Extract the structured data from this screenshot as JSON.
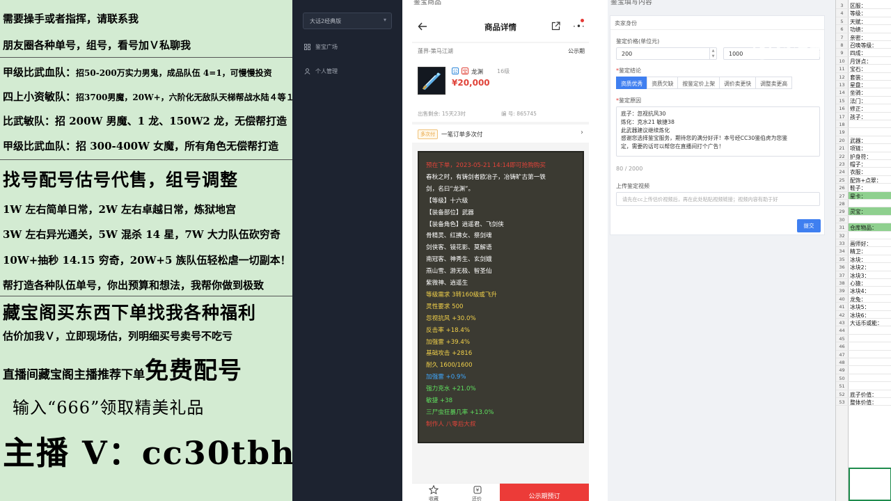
{
  "promo": {
    "lines": [
      "需要操手或者指挥，请联系我",
      "朋友圈各种单号，组号，看号加Ｖ私聊我",
      "甲级比武血队：",
      "招50-200万实力男鬼，成品队伍 4=1，可慢慢投资",
      "四上小资敏队：",
      "招3700男魔，20W+，六阶化无敌队天梯帮战水陆４等１",
      "比武敏队：招 200W 男魔、1 龙、150W2 龙，无偿帮打造",
      "甲级比武血队：招 300-400W 女魔，所有角色无偿帮打造",
      "找号配号估号代售，组号调整",
      "1W 左右简单日常，2W 左右卓越日常，炼狱地宫",
      "3W 左右异光通关，5W 混杀 14 星，7W 大力队伍砍穷奇",
      "10W+抽秒 14.15 穷奇，20W+5 族队伍轻松虐一切副本！",
      "帮打造各种队伍单号，你出预算和想法，我帮你做到极致",
      "藏宝阁买东西下单找我各种福利",
      "估价加我Ｖ，立即现场估，列明细买号卖号不吃亏",
      "直播间藏宝阁主播推荐下单",
      "免费配号",
      "输入“666”领取精美礼品",
      "主播 V：cc30tbh"
    ]
  },
  "sidebar": {
    "game_select": "大话2经典版",
    "items": [
      {
        "label": "鉴宝广场",
        "icon": "grid-icon"
      },
      {
        "label": "个人管理",
        "icon": "user-icon"
      }
    ]
  },
  "phone": {
    "top_label": "鉴宝商品",
    "nav_title": "商品详情",
    "server": "蓬界-策马江湖",
    "status": "公示期",
    "badge_1": "公",
    "badge_2": "宝",
    "item_name": "龙渊",
    "item_level": "16级",
    "price": "¥20,000",
    "remaining": "出售剩余: 15天23时",
    "serial": "编 号: 865745",
    "pay_tag": "多次付",
    "pay_text": "一笔订单多次付",
    "description": [
      {
        "t": "预在下单，2023-05-21 14:14即可抢购购买",
        "c": "#e0443a"
      },
      {
        "t": "春秋之时，有铸剑者欧冶子，冶铸旷古第一铁",
        "c": "#ffffff"
      },
      {
        "t": "剑，名曰“龙渊”。",
        "c": "#ffffff"
      },
      {
        "t": "【等级】十六级",
        "c": "#ffffff"
      },
      {
        "t": "【装备部位】武器",
        "c": "#ffffff"
      },
      {
        "t": "【装备角色】逍遥君、飞剑侠",
        "c": "#ffffff"
      },
      {
        "t": "骨精灵、红拂女、祭剑魂",
        "c": "#ffffff"
      },
      {
        "t": "剑侠客、镜花影、莫解语",
        "c": "#ffffff"
      },
      {
        "t": "南冠客、神秀生、玄剑娥",
        "c": "#ffffff"
      },
      {
        "t": "燕山雪、游无极、智圣仙",
        "c": "#ffffff"
      },
      {
        "t": "紫微神、逍遥生",
        "c": "#ffffff"
      },
      {
        "t": "等级需求 3转160级或飞升",
        "c": "#f2d14a"
      },
      {
        "t": "灵性要求 500",
        "c": "#f2d14a"
      },
      {
        "t": "忽视抗风 +30.0%",
        "c": "#f2d14a"
      },
      {
        "t": "反击率 +18.4%",
        "c": "#f2d14a"
      },
      {
        "t": "加强雷 +39.4%",
        "c": "#f2d14a"
      },
      {
        "t": "基础攻击 +2816",
        "c": "#f2d14a"
      },
      {
        "t": "耐久 1600/1600",
        "c": "#f2d14a"
      },
      {
        "t": "加强雷 +0.9%",
        "c": "#3fa8ff"
      },
      {
        "t": "强力克水 +21.0%",
        "c": "#5fe05f"
      },
      {
        "t": "敏捷 +38",
        "c": "#5fe05f"
      },
      {
        "t": "三尸虫狂暴几率 +13.0%",
        "c": "#5fe05f"
      },
      {
        "t": "制作人 八零后大叔",
        "c": "#e0443a"
      }
    ],
    "fav_label": "收藏",
    "bid_label": "还价",
    "buy_label": "公示期预订"
  },
  "form": {
    "top_label": "鉴宝填写内容",
    "section": "卖家身份",
    "price_label": "鉴定价格(单位元)",
    "price_min": "200",
    "price_max": "1000",
    "verdict_label": "鉴定结论",
    "verdict_options": [
      "资质优秀",
      "资质欠缺",
      "按鉴定价上架",
      "调价卖更快",
      "调整卖更高"
    ],
    "verdict_selected": 0,
    "reason_label": "鉴定原因",
    "reason_lines": [
      "底子：忽视抗风30",
      "炼化：克水21 敏捷38",
      "此武器建议继续炼化",
      "感谢您选择鉴宝服务，期待您的满分好评！本号经CC30鉴伯虎为您鉴",
      "定，需要的话可以帮您在直播间打个广告！"
    ],
    "char_count": "80 / 2000",
    "video_label": "上传鉴定视频",
    "video_placeholder": "请先在cc上传估价视频后，再在此处粘贴视频链接；视频内容有助于好",
    "submit_label": "提交"
  },
  "sheet": {
    "rows": [
      {
        "n": "3",
        "v": "区服："
      },
      {
        "n": "4",
        "v": "等级："
      },
      {
        "n": "5",
        "v": "天赋："
      },
      {
        "n": "6",
        "v": "功绩："
      },
      {
        "n": "7",
        "v": "亲密："
      },
      {
        "n": "8",
        "v": "召唤等级："
      },
      {
        "n": "9",
        "v": "四成："
      },
      {
        "n": "10",
        "v": "月饼点："
      },
      {
        "n": "11",
        "v": "宝石："
      },
      {
        "n": "12",
        "v": "套装："
      },
      {
        "n": "13",
        "v": "星盘："
      },
      {
        "n": "14",
        "v": "坐骑："
      },
      {
        "n": "15",
        "v": "法门："
      },
      {
        "n": "16",
        "v": "修正："
      },
      {
        "n": "17",
        "v": "孩子："
      },
      {
        "n": "18",
        "v": ""
      },
      {
        "n": "19",
        "v": ""
      },
      {
        "n": "20",
        "v": "武器："
      },
      {
        "n": "21",
        "v": "项链："
      },
      {
        "n": "22",
        "v": "护身符："
      },
      {
        "n": "23",
        "v": "帽子："
      },
      {
        "n": "24",
        "v": "衣服："
      },
      {
        "n": "25",
        "v": "配饰+点翠："
      },
      {
        "n": "26",
        "v": "鞋子："
      },
      {
        "n": "27",
        "v": "星卡："
      },
      {
        "n": "28",
        "v": ""
      },
      {
        "n": "29",
        "v": "灵宝："
      },
      {
        "n": "30",
        "v": ""
      },
      {
        "n": "31",
        "v": "仓库物品："
      },
      {
        "n": "32",
        "v": ""
      },
      {
        "n": "33",
        "v": "画师好："
      },
      {
        "n": "34",
        "v": "精卫："
      },
      {
        "n": "35",
        "v": "冰块："
      },
      {
        "n": "36",
        "v": "冰块2："
      },
      {
        "n": "37",
        "v": "冰块3："
      },
      {
        "n": "38",
        "v": "心猿："
      },
      {
        "n": "39",
        "v": "冰块4："
      },
      {
        "n": "40",
        "v": "龙兔："
      },
      {
        "n": "41",
        "v": "冰块5："
      },
      {
        "n": "42",
        "v": "冰块6："
      },
      {
        "n": "43",
        "v": "大话币或能："
      },
      {
        "n": "44",
        "v": ""
      },
      {
        "n": "45",
        "v": ""
      },
      {
        "n": "46",
        "v": ""
      },
      {
        "n": "47",
        "v": ""
      },
      {
        "n": "48",
        "v": ""
      },
      {
        "n": "49",
        "v": ""
      },
      {
        "n": "50",
        "v": ""
      },
      {
        "n": "51",
        "v": ""
      },
      {
        "n": "52",
        "v": "底子价值："
      },
      {
        "n": "53",
        "v": "整体价值："
      }
    ],
    "highlight_rows": [
      "27",
      "29",
      "31"
    ]
  },
  "watermark": "CC直播"
}
